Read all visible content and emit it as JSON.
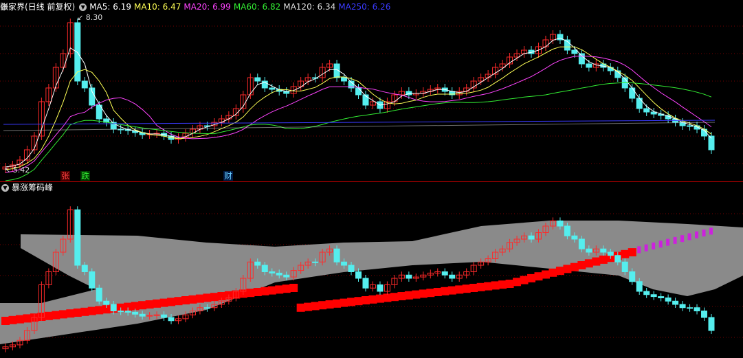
{
  "main": {
    "title": "张家界(日线 前复权)",
    "indicators": [
      {
        "label": "MA5: 6.19",
        "color": "#ffffff"
      },
      {
        "label": "MA10: 6.47",
        "color": "#ffff55"
      },
      {
        "label": "MA20: 6.99",
        "color": "#ff44ff"
      },
      {
        "label": "MA60: 6.82",
        "color": "#33ee33"
      },
      {
        "label": "MA120: 6.34",
        "color": "#dddddd"
      },
      {
        "label": "MA250: 6.26",
        "color": "#3a3aff"
      }
    ],
    "high_label": "8.30",
    "low_label": "5.42",
    "events": [
      {
        "text": "张",
        "color": "#ff4040",
        "bg": "#4a0000"
      },
      {
        "text": "跌",
        "color": "#33ee33",
        "bg": "#003a00"
      },
      {
        "text": "财",
        "color": "#66ccff",
        "bg": "#001a44"
      }
    ]
  },
  "sub": {
    "title": "暴涨筹码峰"
  },
  "colors": {
    "up": "#ff2a2a",
    "down": "#55eeee",
    "grid": "#7a0000",
    "band": "#8a8a8a",
    "peak": "#ff0000",
    "tail": "#cc22dd"
  }
}
